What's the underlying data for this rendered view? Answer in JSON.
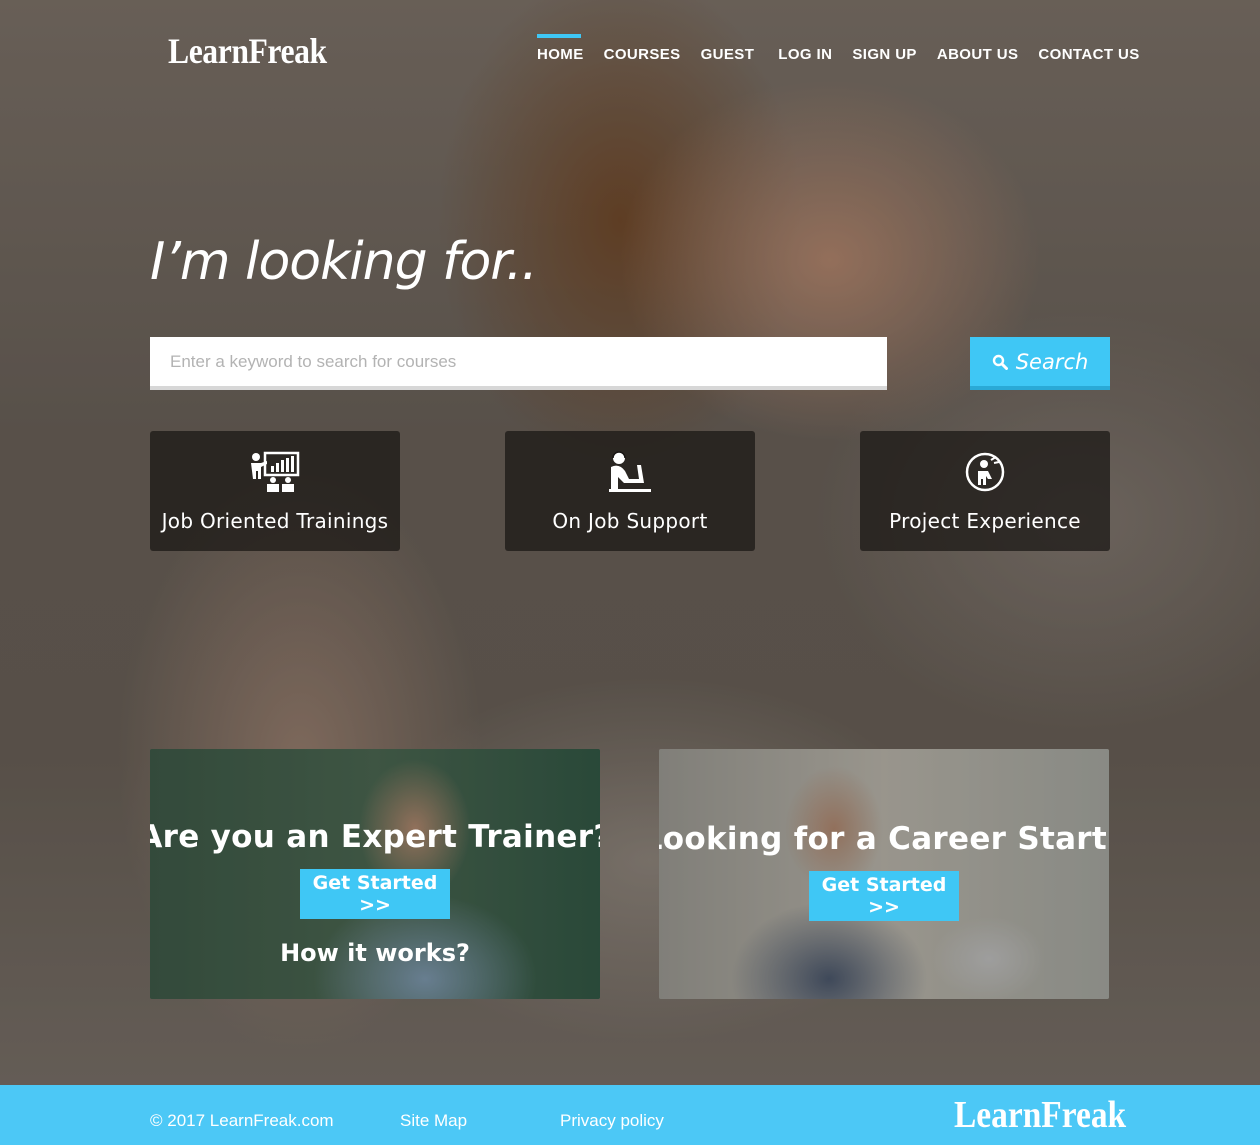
{
  "header": {
    "logo": "LearnFreak",
    "nav": [
      {
        "label": "HOME",
        "active": true
      },
      {
        "label": "COURSES",
        "active": false
      },
      {
        "label": "GUEST",
        "active": false
      },
      {
        "label": "LOG IN",
        "active": false
      },
      {
        "label": "SIGN UP",
        "active": false
      },
      {
        "label": "ABOUT US",
        "active": false
      },
      {
        "label": "CONTACT US",
        "active": false
      }
    ]
  },
  "hero": {
    "headline": "I’m looking for..",
    "search": {
      "placeholder": "Enter a keyword to search for courses",
      "value": "",
      "button_label": "Search",
      "button_icon": "search-icon"
    }
  },
  "features": [
    {
      "label": "Job Oriented Trainings",
      "icon": "presentation-chart-icon"
    },
    {
      "label": "On Job Support",
      "icon": "person-at-desk-icon"
    },
    {
      "label": "Project Experience",
      "icon": "person-in-circle-icon"
    }
  ],
  "promos": {
    "trainer": {
      "title": "Are you an Expert Trainer?",
      "button_label": "Get Started >>",
      "link_label": "How it works?"
    },
    "career": {
      "title": "Looking for a Career Start?",
      "button_label": "Get Started >>"
    }
  },
  "footer": {
    "copyright": "© 2017 LearnFreak.com",
    "links": [
      "Site Map",
      "Privacy policy"
    ],
    "logo": "LearnFreak"
  },
  "colors": {
    "accent": "#3fc7f5",
    "footer_bg": "#4cc8f6",
    "card_bg": "#191614"
  }
}
